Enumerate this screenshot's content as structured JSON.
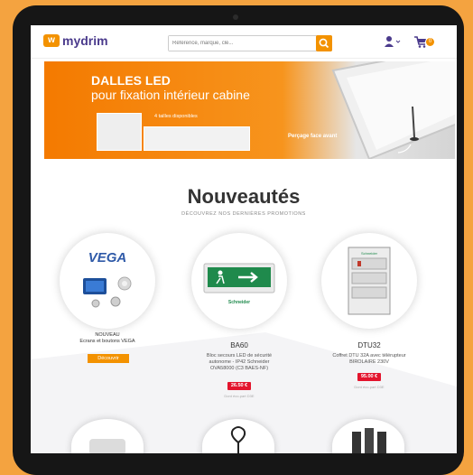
{
  "header": {
    "logo_text": "mydrim",
    "logo_mark": "w",
    "search_placeholder": "Référence, marque, clé...",
    "cart_count": "0"
  },
  "banner": {
    "title": "DALLES LED",
    "subtitle": "pour fixation intérieur cabine",
    "note": "4 tailles disponibles",
    "caption": "Perçage face avant"
  },
  "section": {
    "title": "Nouveautés",
    "subtitle": "DÉCOUVREZ NOS DERNIÈRES PROMOTIONS"
  },
  "products": [
    {
      "brand": "VEGA",
      "name": "NOUVEAU\nEcrans et boutons VEGA",
      "button": "Découvrir"
    },
    {
      "name": "BA60",
      "desc": "Bloc secours LED de sécurité autonome - IP42 Schneider OVA58000 (C3 BAES-NF)",
      "price": "26.50 €",
      "note": "Dont éco-part D3E"
    },
    {
      "name": "DTU32",
      "desc": "Coffret DTU 32A avec télérupteur BIROLAIRE 230V",
      "price": "95.00 €",
      "note": "Dont éco-part D3E"
    }
  ],
  "colors": {
    "accent": "#f39200",
    "brand": "#4a3a8c",
    "price": "#e3142d",
    "background": "#f4a340"
  },
  "icons": [
    "search-icon",
    "user-icon",
    "cart-icon"
  ]
}
